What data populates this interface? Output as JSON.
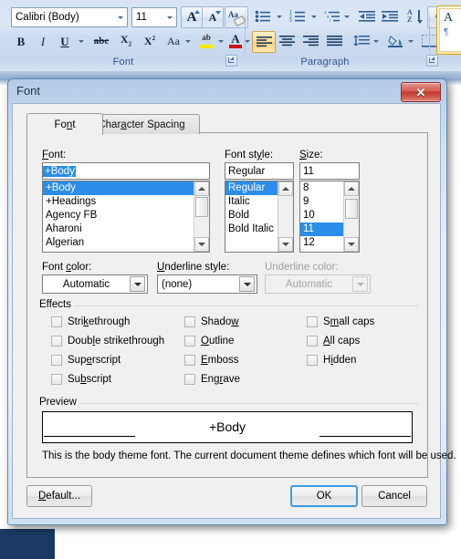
{
  "ribbon": {
    "font_group": {
      "label": "Font",
      "font_name": "Calibri (Body)",
      "font_size": "11",
      "grow_font": "A",
      "shrink_font": "A",
      "clear_formatting": "Aa",
      "bold": "B",
      "italic": "I",
      "underline": "U",
      "strikethrough": "abc",
      "subscript": "X",
      "subscript_sub": "2",
      "superscript": "X",
      "superscript_sup": "2",
      "change_case": "Aa",
      "highlight": "ab",
      "font_color": "A"
    },
    "paragraph_group": {
      "label": "Paragraph"
    },
    "styles_group": {
      "style_letter": "A",
      "style_mark": "¶"
    }
  },
  "dialog": {
    "title": "Font",
    "close_label": "✕",
    "tabs": [
      {
        "label_pre": "Fo",
        "label_acc": "n",
        "label_post": "t",
        "selected": true
      },
      {
        "label_pre": "Char",
        "label_acc": "a",
        "label_post": "cter Spacing",
        "selected": false
      }
    ],
    "font_field": {
      "label_pre": "",
      "label_acc": "F",
      "label_post": "ont:",
      "value": "+Body",
      "options": [
        "+Body",
        "+Headings",
        "Agency FB",
        "Aharoni",
        "Algerian"
      ],
      "selected_index": 0
    },
    "style_field": {
      "label_pre": "Font st",
      "label_acc": "y",
      "label_post": "le:",
      "value": "Regular",
      "options": [
        "Regular",
        "Italic",
        "Bold",
        "Bold Italic"
      ],
      "selected_index": 0
    },
    "size_field": {
      "label_pre": "",
      "label_acc": "S",
      "label_post": "ize:",
      "value": "11",
      "options": [
        "8",
        "9",
        "10",
        "11",
        "12"
      ],
      "selected_index": 3
    },
    "font_color": {
      "label_pre": "Font ",
      "label_acc": "c",
      "label_post": "olor:",
      "value": "Automatic",
      "disabled": false
    },
    "underline_style": {
      "label_pre": "",
      "label_acc": "U",
      "label_post": "nderline style:",
      "value": "(none)",
      "disabled": false
    },
    "underline_color": {
      "label_pre": "Underline color:",
      "label_acc": "",
      "label_post": "",
      "value": "Automatic",
      "disabled": true
    },
    "effects": {
      "legend": "Effects",
      "items": [
        {
          "pre": "Stri",
          "acc": "k",
          "post": "ethrough",
          "checked": false,
          "col": 0,
          "row": 0
        },
        {
          "pre": "Doub",
          "acc": "l",
          "post": "e strikethrough",
          "checked": false,
          "col": 0,
          "row": 1
        },
        {
          "pre": "Sup",
          "acc": "e",
          "post": "rscript",
          "checked": false,
          "col": 0,
          "row": 2
        },
        {
          "pre": "Su",
          "acc": "b",
          "post": "script",
          "checked": false,
          "col": 0,
          "row": 3
        },
        {
          "pre": "Shado",
          "acc": "w",
          "post": "",
          "checked": false,
          "col": 1,
          "row": 0
        },
        {
          "pre": "",
          "acc": "O",
          "post": "utline",
          "checked": false,
          "col": 1,
          "row": 1
        },
        {
          "pre": "",
          "acc": "E",
          "post": "mboss",
          "checked": false,
          "col": 1,
          "row": 2
        },
        {
          "pre": "Eng",
          "acc": "r",
          "post": "ave",
          "checked": false,
          "col": 1,
          "row": 3
        },
        {
          "pre": "S",
          "acc": "m",
          "post": "all caps",
          "checked": false,
          "col": 2,
          "row": 0
        },
        {
          "pre": "",
          "acc": "A",
          "post": "ll caps",
          "checked": false,
          "col": 2,
          "row": 1
        },
        {
          "pre": "H",
          "acc": "i",
          "post": "dden",
          "checked": false,
          "col": 2,
          "row": 2
        }
      ]
    },
    "preview": {
      "legend": "Preview",
      "sample_text": "+Body",
      "description": "This is the body theme font. The current document theme defines which font will be used."
    },
    "buttons": {
      "default_pre": "",
      "default_acc": "D",
      "default_post": "efault...",
      "ok": "OK",
      "cancel": "Cancel"
    }
  },
  "colors": {
    "accent": "#2a8dea",
    "close_red": "#c2392f",
    "ribbon_label": "#32558e",
    "default_button_border": "#3c9de0"
  }
}
